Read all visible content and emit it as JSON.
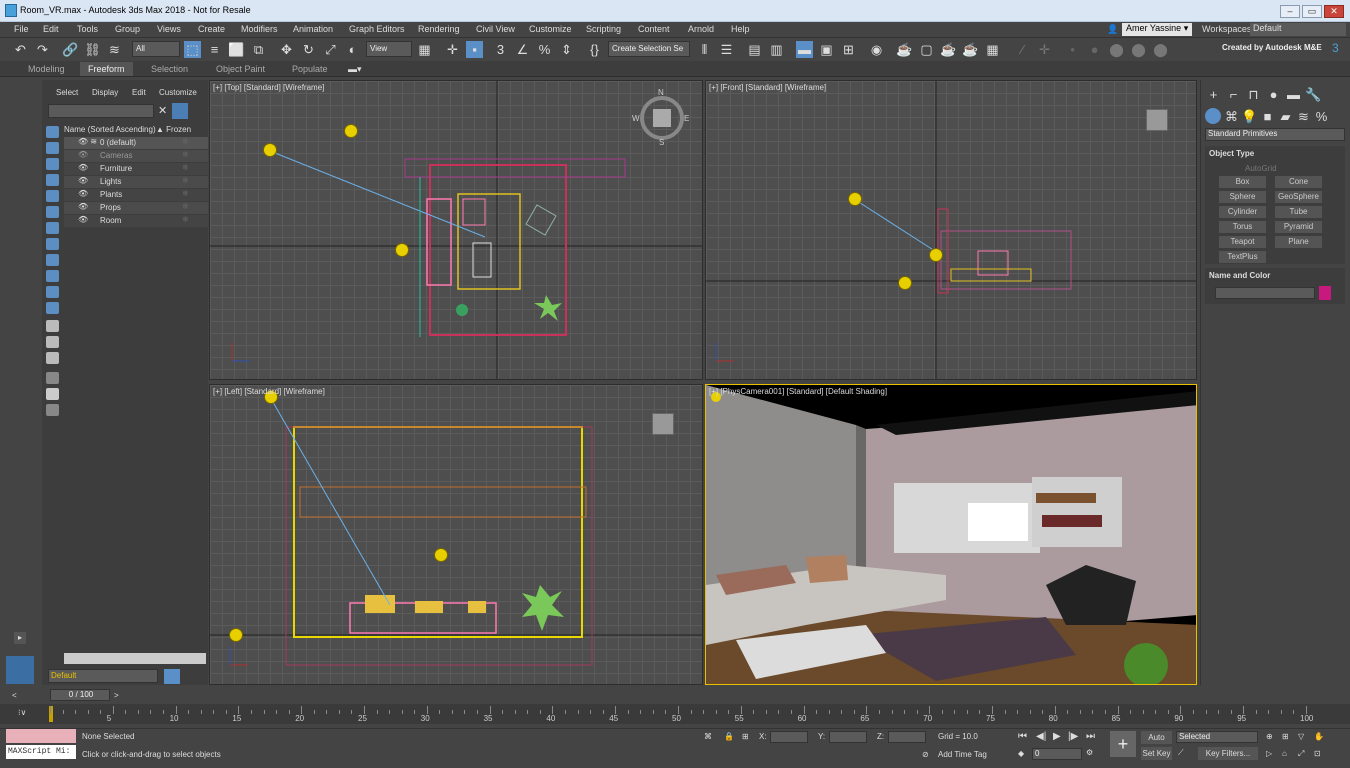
{
  "window": {
    "title": "Room_VR.max - Autodesk 3ds Max 2018 - Not for Resale",
    "btn_min": "–",
    "btn_max": "▭",
    "btn_close": "✕"
  },
  "menu": [
    "File",
    "Edit",
    "Tools",
    "Group",
    "Views",
    "Create",
    "Modifiers",
    "Animation",
    "Graph Editors",
    "Rendering",
    "Civil View",
    "Customize",
    "Scripting",
    "Content",
    "Arnold",
    "Help"
  ],
  "user": {
    "name": "Amer Yassine",
    "workspaces_label": "Workspaces:",
    "workspace": "Default",
    "credit": "Created by Autodesk M&E"
  },
  "toolbar": {
    "filter": "All",
    "view": "View",
    "selection_set": "Create Selection Se"
  },
  "ribbon": {
    "tabs": [
      "Modeling",
      "Freeform",
      "Selection",
      "Object Paint",
      "Populate"
    ],
    "active": "Freeform"
  },
  "explorer": {
    "tabs": [
      "Select",
      "Display",
      "Edit",
      "Customize"
    ],
    "col_name": "Name (Sorted Ascending)",
    "col_frozen": "▲ Frozen",
    "rows": [
      "0 (default)",
      "Cameras",
      "Furniture",
      "Lights",
      "Plants",
      "Props",
      "Room"
    ],
    "layer": "Default"
  },
  "viewports": {
    "top": "[+] [Top] [Standard] [Wireframe]",
    "front": "[+] [Front] [Standard] [Wireframe]",
    "left": "[+] [Left] [Standard] [Wireframe]",
    "camera": "[+] [PhysCamera001] [Standard] [Default Shading]",
    "compass": {
      "n": "N",
      "s": "S",
      "e": "E",
      "w": "W"
    }
  },
  "command_panel": {
    "category": "Standard Primitives",
    "object_type": "Object Type",
    "autogrid": "AutoGrid",
    "buttons": [
      "Box",
      "Cone",
      "Sphere",
      "GeoSphere",
      "Cylinder",
      "Tube",
      "Torus",
      "Pyramid",
      "Teapot",
      "Plane",
      "TextPlus"
    ],
    "name_color": "Name and Color",
    "swatch_color": "#c8197e"
  },
  "timeline": {
    "frame": "0 / 100",
    "ticks": [
      "5",
      "10",
      "15",
      "20",
      "25",
      "30",
      "35",
      "40",
      "45",
      "50",
      "55",
      "60",
      "65",
      "70",
      "75",
      "80",
      "85",
      "90",
      "95",
      "100"
    ]
  },
  "status": {
    "maxscript": "MAXScript Mi:",
    "none_selected": "None Selected",
    "prompt": "Click or click-and-drag to select objects",
    "x": "X:",
    "y": "Y:",
    "z": "Z:",
    "grid": "Grid = 10.0",
    "add_time_tag": "Add Time Tag",
    "frame_val": "0",
    "auto_key": "Auto Key",
    "set_key": "Set Key",
    "selected": "Selected",
    "key_filters": "Key Filters..."
  }
}
